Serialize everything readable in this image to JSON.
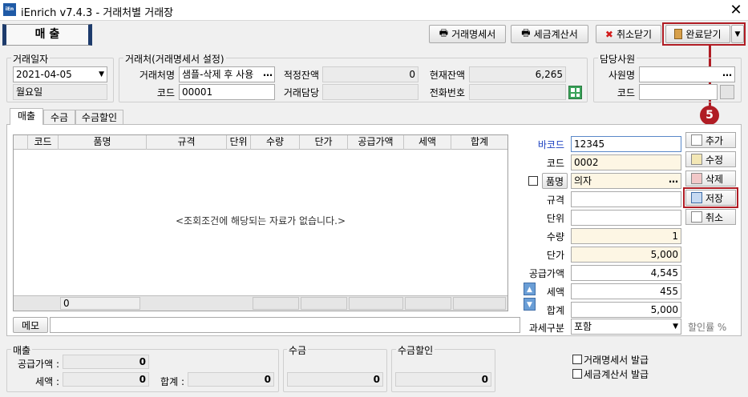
{
  "window": {
    "title": "iEnrich v7.4.3 - 거래처별 거래장",
    "app_icon_text": "iEn",
    "close": "✕"
  },
  "mode_label": "매 출",
  "toolbar": {
    "statement": "거래명세서",
    "tax_invoice": "세금계산서",
    "cancel_close": "취소닫기",
    "done_close": "완료닫기"
  },
  "annotation": {
    "step": "5"
  },
  "trade_date": {
    "label": "거래일자",
    "value": "2021-04-05",
    "weekday": "월요일"
  },
  "client": {
    "group_label": "거래처(거래명세서 설정)",
    "name_label": "거래처명",
    "name_value": "샘플-삭제 후 사용",
    "code_label": "코드",
    "code_value": "00001",
    "opening_label": "적정잔액",
    "opening_value": "0",
    "current_label": "현재잔액",
    "current_value": "6,265",
    "contact_label": "거래담당",
    "contact_value": "",
    "phone_label": "전화번호",
    "phone_value": ""
  },
  "staff": {
    "group_label": "담당사원",
    "name_label": "사원명",
    "name_value": "",
    "code_label": "코드",
    "code_value": ""
  },
  "tabs": [
    "매출",
    "수금",
    "수금할인"
  ],
  "grid": {
    "columns": [
      "코드",
      "품명",
      "규격",
      "단위",
      "수량",
      "단가",
      "공급가액",
      "세액",
      "합계"
    ],
    "empty_message": "<조회조건에 해당되는 자료가 없습니다.>",
    "footer_count": "0"
  },
  "item": {
    "barcode_label": "바코드",
    "barcode_value": "12345",
    "code_label": "코드",
    "code_value": "0002",
    "name_label": "품명",
    "name_value": "의자",
    "spec_label": "규격",
    "spec_value": "",
    "unit_label": "단위",
    "unit_value": "",
    "qty_label": "수량",
    "qty_value": "1",
    "price_label": "단가",
    "price_value": "5,000",
    "supply_label": "공급가액",
    "supply_value": "4,545",
    "tax_label": "세액",
    "tax_value": "455",
    "total_label": "합계",
    "total_value": "5,000",
    "tax_type_label": "과세구분",
    "tax_type_value": "포함",
    "discount_label": "할인률 %"
  },
  "side_buttons": {
    "add": "추가",
    "edit": "수정",
    "delete": "삭제",
    "save": "저장",
    "cancel": "취소"
  },
  "memo": {
    "label": "메모",
    "value": ""
  },
  "summary": {
    "sales_label": "매출",
    "supply_label": "공급가액 :",
    "supply_value": "0",
    "tax_label": "세액 :",
    "tax_value": "0",
    "total_label": "합계 :",
    "total_value": "0",
    "collect_label": "수금",
    "collect_value": "0",
    "discount_label": "수금할인",
    "discount_value": "0"
  },
  "print_options": {
    "statement": "거래명세서 발급",
    "tax_invoice": "세금계산서 발급"
  },
  "colors": {
    "accent_red": "#b01c24",
    "barcode_blue": "#1a3fc0",
    "cream": "#fdf6e4"
  }
}
